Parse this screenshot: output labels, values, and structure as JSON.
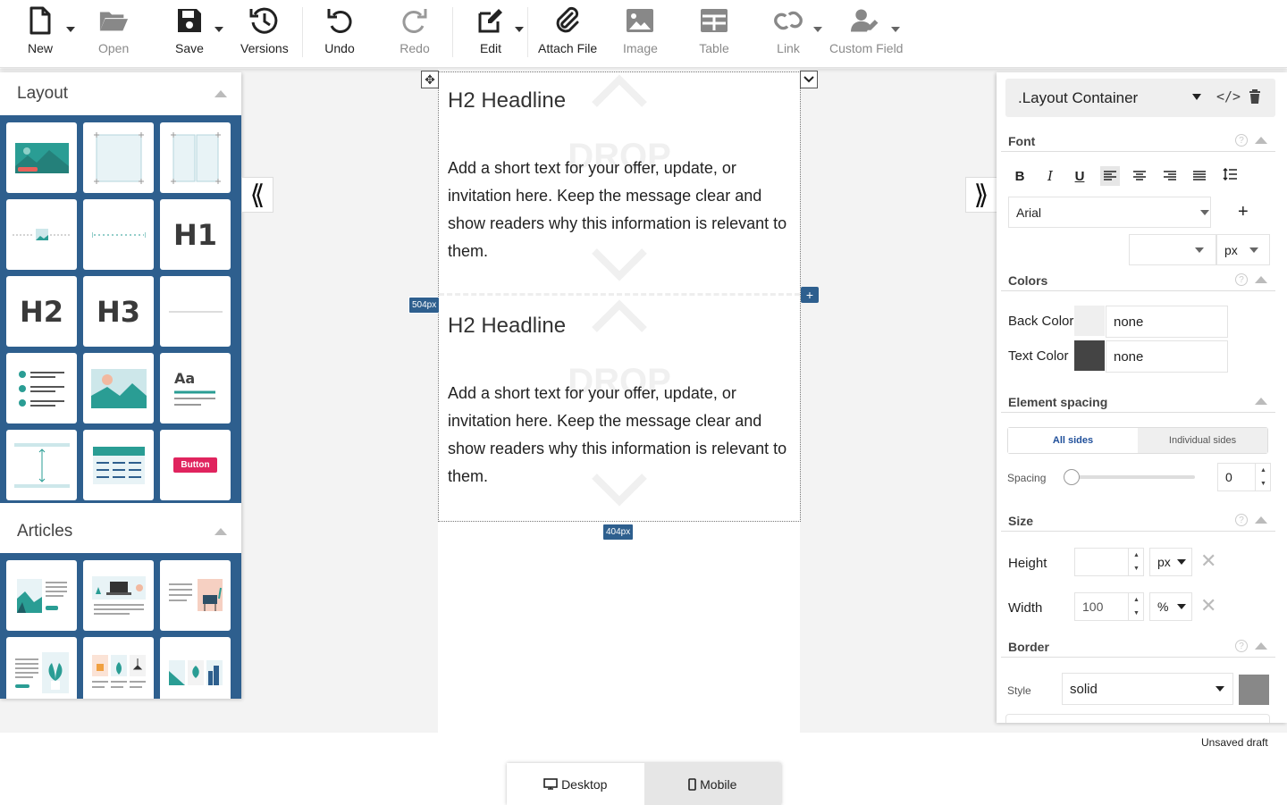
{
  "toolbar": {
    "new": "New",
    "open": "Open",
    "save": "Save",
    "versions": "Versions",
    "undo": "Undo",
    "redo": "Redo",
    "edit": "Edit",
    "attach": "Attach File",
    "image": "Image",
    "table": "Table",
    "link": "Link",
    "custom_field": "Custom Field"
  },
  "left_panel": {
    "layout_title": "Layout",
    "articles_title": "Articles",
    "layout_tiles": [
      "image-banner",
      "frame-single",
      "frame-two-column",
      "image-inline",
      "divider-dotted",
      "H1",
      "H2",
      "H3",
      "divider-line",
      "checklist",
      "image",
      "text-block",
      "spacer",
      "table",
      "Button"
    ],
    "button_tile_label": "Button",
    "text_tile_label": "Aa"
  },
  "canvas": {
    "sections": [
      {
        "headline": "H2 Headline",
        "body": "Add a short text for your offer, update, or invitation here. Keep the message clear and show readers why this information is relevant to them."
      },
      {
        "headline": "H2 Headline",
        "body": "Add a short text for your offer, update, or invitation here. Keep the message clear and show readers why this information is relevant to them."
      }
    ],
    "height_badge": "504px",
    "width_badge": "404px",
    "drop_text": "DROP"
  },
  "right_panel": {
    "element": ".Layout Container",
    "font": {
      "title": "Font",
      "family": "Arial",
      "size": "",
      "unit": "px"
    },
    "colors": {
      "title": "Colors",
      "back_label": "Back Color",
      "back_value": "none",
      "back_swatch": "#efefef",
      "text_label": "Text Color",
      "text_value": "none",
      "text_swatch": "#444444"
    },
    "spacing": {
      "title": "Element spacing",
      "all_sides": "All sides",
      "individual": "Individual sides",
      "label": "Spacing",
      "value": "0"
    },
    "size": {
      "title": "Size",
      "height_label": "Height",
      "height_value": "",
      "height_unit": "px",
      "width_label": "Width",
      "width_value": "100",
      "width_unit": "%"
    },
    "border": {
      "title": "Border",
      "style_label": "Style",
      "style_value": "solid",
      "color": "#888888"
    }
  },
  "footer": {
    "status": "Unsaved draft",
    "desktop": "Desktop",
    "mobile": "Mobile"
  },
  "colors": {
    "accent_blue": "#2e5f8e",
    "teal": "#2a9d94",
    "coral": "#e8615a",
    "button_red": "#e0245e"
  }
}
